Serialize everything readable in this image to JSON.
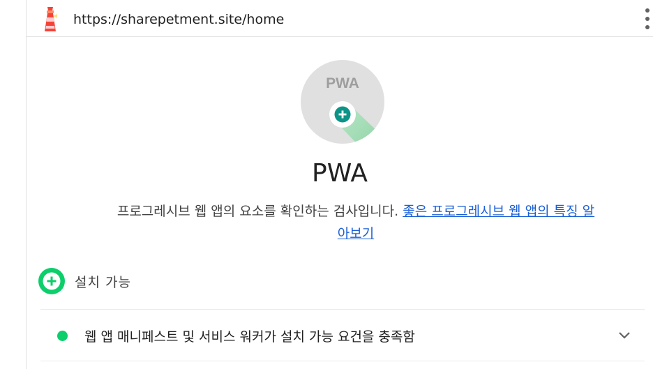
{
  "topbar": {
    "logo_icon": "lighthouse-icon",
    "url": "https://sharepetment.site/home",
    "menu_icon": "more-vert-icon"
  },
  "category": {
    "gauge_icon": "pwa-badge-icon",
    "gauge_text": "PWA",
    "title": "PWA",
    "description": "프로그레시브 웹 앱의 요소를 확인하는 검사입니다.",
    "link_text": "좋은 프로그레시브 웹 앱의 특징 알아보기"
  },
  "group": {
    "icon": "installable-plus-icon",
    "title": "설치 가능"
  },
  "audits": [
    {
      "status": "pass",
      "status_color": "#0cce6b",
      "title": "웹 앱 매니페스트 및 서비스 워커가 설치 가능 요건을 충족함"
    }
  ],
  "colors": {
    "pass": "#0cce6b",
    "link": "#1a5fd6",
    "badge_plus": "#0d9488",
    "gauge_bg": "#e0e0e0"
  }
}
